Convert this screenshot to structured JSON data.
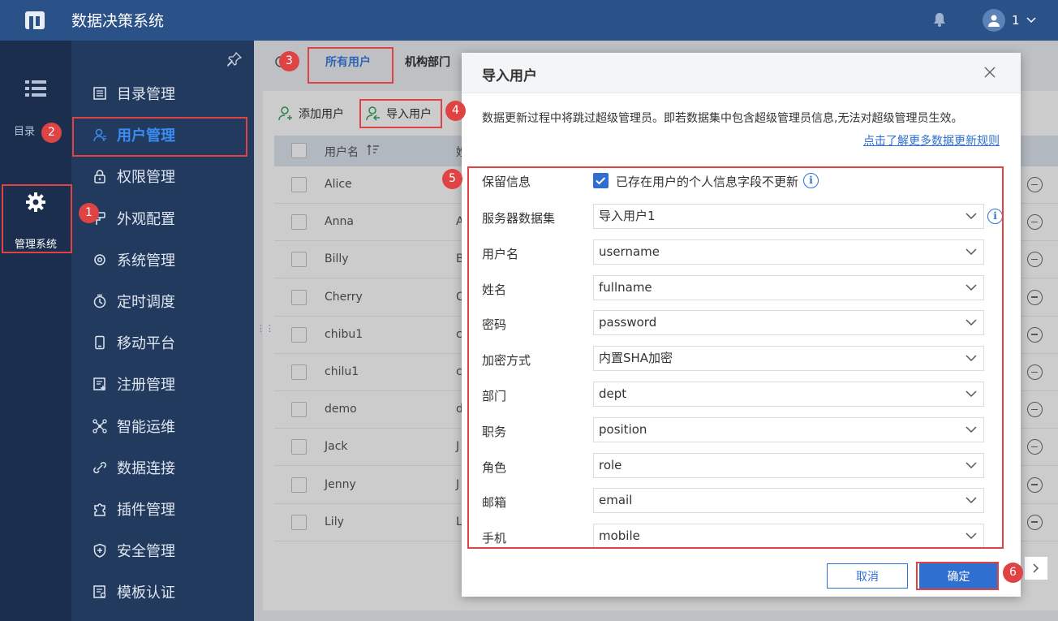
{
  "header": {
    "app_title": "数据决策系统",
    "user_name": "1"
  },
  "rail": {
    "directory_label": "目录",
    "manage_label": "管理系统"
  },
  "menu": {
    "items": [
      {
        "label": "目录管理",
        "icon": "catalog-icon"
      },
      {
        "label": "用户管理",
        "icon": "user-icon"
      },
      {
        "label": "权限管理",
        "icon": "lock-icon"
      },
      {
        "label": "外观配置",
        "icon": "brush-icon"
      },
      {
        "label": "系统管理",
        "icon": "gear-icon"
      },
      {
        "label": "定时调度",
        "icon": "timer-icon"
      },
      {
        "label": "移动平台",
        "icon": "mobile-icon"
      },
      {
        "label": "注册管理",
        "icon": "register-icon"
      },
      {
        "label": "智能运维",
        "icon": "network-icon"
      },
      {
        "label": "数据连接",
        "icon": "link-icon"
      },
      {
        "label": "插件管理",
        "icon": "puzzle-icon"
      },
      {
        "label": "安全管理",
        "icon": "shield-icon"
      },
      {
        "label": "模板认证",
        "icon": "certificate-icon"
      }
    ],
    "active_index": 1
  },
  "tabs": {
    "all_users": "所有用户",
    "org_dept": "机构部门"
  },
  "toolbar": {
    "add_user": "添加用户",
    "import_user": "导入用户"
  },
  "table": {
    "header_username": "用户名",
    "header_col2": "姓",
    "rows": [
      {
        "name": "Alice",
        "c2": ""
      },
      {
        "name": "Anna",
        "c2": "A"
      },
      {
        "name": "Billy",
        "c2": "B"
      },
      {
        "name": "Cherry",
        "c2": "C"
      },
      {
        "name": "chibu1",
        "c2": "c"
      },
      {
        "name": "chilu1",
        "c2": "c"
      },
      {
        "name": "demo",
        "c2": "d"
      },
      {
        "name": "Jack",
        "c2": "J"
      },
      {
        "name": "Jenny",
        "c2": "J"
      },
      {
        "name": "Lily",
        "c2": "L"
      }
    ]
  },
  "modal": {
    "title": "导入用户",
    "notice": "数据更新过程中将跳过超级管理员。即若数据集中包含超级管理员信息,无法对超级管理员生效。",
    "learn_more": "点击了解更多数据更新规则",
    "keep_info_label": "保留信息",
    "keep_info_checkbox_label": "已存在用户的个人信息字段不更新",
    "keep_info_checked": true,
    "fields": [
      {
        "label": "服务器数据集",
        "value": "导入用户1"
      },
      {
        "label": "用户名",
        "value": "username"
      },
      {
        "label": "姓名",
        "value": "fullname"
      },
      {
        "label": "密码",
        "value": "password"
      },
      {
        "label": "加密方式",
        "value": "内置SHA加密"
      },
      {
        "label": "部门",
        "value": "dept"
      },
      {
        "label": "职务",
        "value": "position"
      },
      {
        "label": "角色",
        "value": "role"
      },
      {
        "label": "邮箱",
        "value": "email"
      },
      {
        "label": "手机",
        "value": "mobile"
      }
    ],
    "cancel_label": "取消",
    "ok_label": "确定"
  },
  "badges": [
    "1",
    "2",
    "3",
    "4",
    "5",
    "6"
  ],
  "colors": {
    "topbar": "#2a5188",
    "menu": "#233a5f",
    "accent": "#2f6fd0",
    "highlight": "#e04343"
  }
}
